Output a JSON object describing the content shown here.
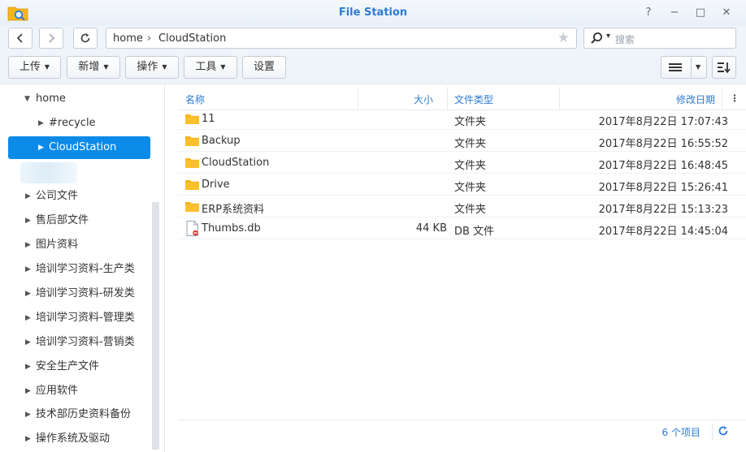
{
  "window": {
    "title": "File Station",
    "help": "?",
    "minimize": "−",
    "maximize": "□",
    "close": "✕"
  },
  "path": {
    "segments": [
      "home",
      "CloudStation"
    ],
    "separator": "›"
  },
  "search": {
    "placeholder": "搜索"
  },
  "toolbar": {
    "upload": "上传",
    "create": "新增",
    "action": "操作",
    "tools": "工具",
    "settings": "设置"
  },
  "sidebar": {
    "items": [
      {
        "label": "home",
        "expanded": true
      },
      {
        "label": "#recycle"
      },
      {
        "label": "CloudStation",
        "selected": true
      },
      {
        "label": "公司文件"
      },
      {
        "label": "售后部文件"
      },
      {
        "label": "图片资料"
      },
      {
        "label": "培训学习资料-生产类"
      },
      {
        "label": "培训学习资料-研发类"
      },
      {
        "label": "培训学习资料-管理类"
      },
      {
        "label": "培训学习资料-营销类"
      },
      {
        "label": "安全生产文件"
      },
      {
        "label": "应用软件"
      },
      {
        "label": "技术部历史资料备份"
      },
      {
        "label": "操作系统及驱动"
      }
    ]
  },
  "list": {
    "columns": {
      "name": "名称",
      "size": "大小",
      "type": "文件类型",
      "modified": "修改日期"
    },
    "rows": [
      {
        "name": "11",
        "size": "",
        "type": "文件夹",
        "modified": "2017年8月22日 17:07:43",
        "kind": "folder"
      },
      {
        "name": "Backup",
        "size": "",
        "type": "文件夹",
        "modified": "2017年8月22日 16:55:52",
        "kind": "folder"
      },
      {
        "name": "CloudStation",
        "size": "",
        "type": "文件夹",
        "modified": "2017年8月22日 16:48:45",
        "kind": "folder"
      },
      {
        "name": "Drive",
        "size": "",
        "type": "文件夹",
        "modified": "2017年8月22日 15:26:41",
        "kind": "folder"
      },
      {
        "name": "ERP系统资料",
        "size": "",
        "type": "文件夹",
        "modified": "2017年8月22日 15:13:23",
        "kind": "folder"
      },
      {
        "name": "Thumbs.db",
        "size": "44 KB",
        "type": "DB 文件",
        "modified": "2017年8月22日 14:45:04",
        "kind": "file"
      }
    ]
  },
  "footer": {
    "count": "6 个项目"
  },
  "colors": {
    "accent": "#2b7bd6",
    "selected": "#0b8ae8",
    "folder": "#f5b51c"
  }
}
